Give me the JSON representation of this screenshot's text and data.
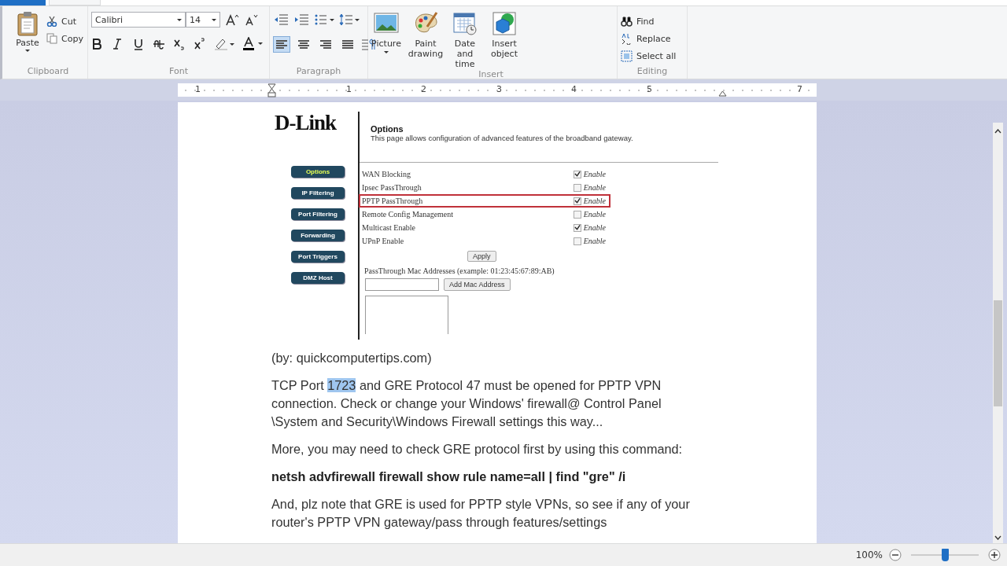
{
  "ribbon": {
    "groups": [
      {
        "kind": "clipboard",
        "label": "Clipboard",
        "paste": "Paste",
        "cut": "Cut",
        "copy": "Copy"
      },
      {
        "kind": "font",
        "label": "Font",
        "font_name": "Calibri",
        "font_size": "14"
      },
      {
        "kind": "paragraph",
        "label": "Paragraph",
        "alignments": [
          {
            "selected": true
          },
          {
            "selected": false
          },
          {
            "selected": false
          },
          {
            "selected": false
          }
        ]
      },
      {
        "kind": "insert",
        "label": "Insert",
        "buttons": [
          {
            "label": "Picture",
            "dropdown": true
          },
          {
            "label": "Paint drawing",
            "dropdown": false
          },
          {
            "label": "Date and time",
            "dropdown": false
          },
          {
            "label": "Insert object",
            "dropdown": false
          }
        ]
      },
      {
        "kind": "editing",
        "label": "Editing",
        "buttons": [
          "Find",
          "Replace",
          "Select all"
        ]
      }
    ]
  },
  "ruler": {
    "numbers": [
      "1",
      "1",
      "2",
      "3",
      "4",
      "5",
      "7"
    ]
  },
  "document": {
    "embedded_page": {
      "logo": "D-Link",
      "title": "Options",
      "description": "This page allows configuration of advanced features of the broadband gateway.",
      "nav": [
        {
          "label": "Options",
          "selected": true
        },
        {
          "label": "IP Filtering",
          "selected": false
        },
        {
          "label": "Port Filtering",
          "selected": false
        },
        {
          "label": "Forwarding",
          "selected": false
        },
        {
          "label": "Port Triggers",
          "selected": false
        },
        {
          "label": "DMZ Host",
          "selected": false
        }
      ],
      "options": [
        {
          "label": "WAN Blocking",
          "checked": true,
          "checkbox_label": "Enable",
          "highlighted": false
        },
        {
          "label": "Ipsec PassThrough",
          "checked": false,
          "checkbox_label": "Enable",
          "highlighted": false
        },
        {
          "label": "PPTP PassThrough",
          "checked": true,
          "checkbox_label": "Enable",
          "highlighted": true
        },
        {
          "label": "Remote Config Management",
          "checked": false,
          "checkbox_label": "Enable",
          "highlighted": false
        },
        {
          "label": "Multicast Enable",
          "checked": true,
          "checkbox_label": "Enable",
          "highlighted": false
        },
        {
          "label": "UPnP Enable",
          "checked": false,
          "checkbox_label": "Enable",
          "highlighted": false
        }
      ],
      "apply_button": "Apply",
      "mac_label": "PassThrough Mac Addresses (example: 01:23:45:67:89:AB)",
      "add_button": "Add Mac Address"
    },
    "paragraphs": [
      {
        "kind": "text",
        "segments": [
          {
            "text": "(by: quickcomputertips.com)",
            "selected": false
          }
        ]
      },
      {
        "kind": "text",
        "segments": [
          {
            "text": "TCP Port ",
            "selected": false
          },
          {
            "text": "1723",
            "selected": true
          },
          {
            "text": " and GRE Protocol 47 must be opened for PPTP VPN connection. Check or change your Windows' firewall@ Control Panel \\System and Security\\Windows Firewall settings this way...",
            "selected": false
          }
        ]
      },
      {
        "kind": "text",
        "segments": [
          {
            "text": "More, you may need to check GRE protocol first by using this command:",
            "selected": false
          }
        ]
      },
      {
        "kind": "command",
        "segments": [
          {
            "text": "netsh advfirewall firewall show rule name=all | find \"gre\" /i",
            "selected": false
          }
        ]
      },
      {
        "kind": "text",
        "segments": [
          {
            "text": "And, plz note that GRE is used for PPTP style VPNs, so see if any of your router's PPTP VPN gateway/pass through features/settings",
            "selected": false
          }
        ]
      }
    ]
  },
  "status_bar": {
    "zoom": "100%",
    "zoom_slider": {
      "level": 0.5
    }
  }
}
